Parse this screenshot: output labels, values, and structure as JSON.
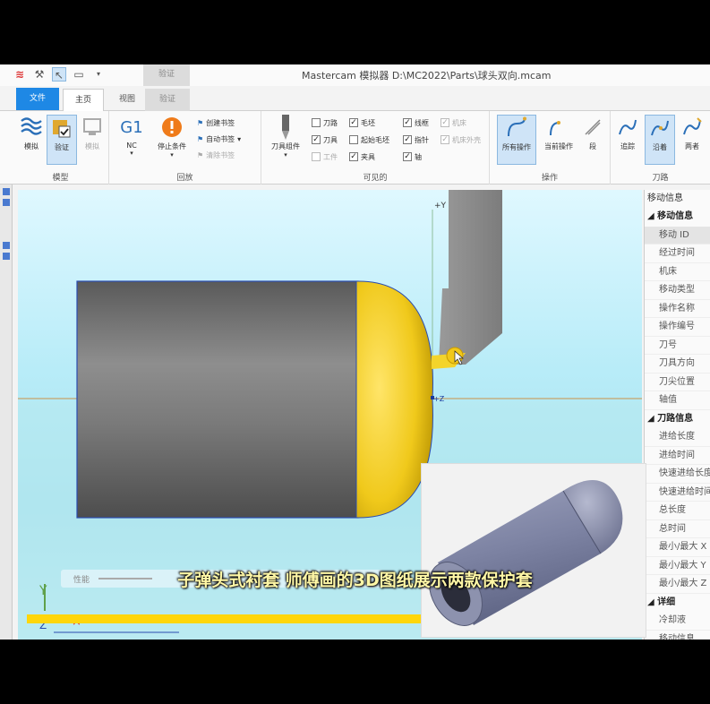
{
  "window": {
    "title": "Mastercam 模拟器  D:\\MC2022\\Parts\\球头双向.mcam",
    "context_tab_group": "验证"
  },
  "quick_access": [
    {
      "icon": "mastercam-logo-icon"
    },
    {
      "icon": "wand-icon"
    },
    {
      "icon": "cursor-icon"
    },
    {
      "icon": "monitor-icon"
    },
    {
      "icon": "dropdown-arrow-icon"
    }
  ],
  "tabs": [
    {
      "label": "文件",
      "name": "file"
    },
    {
      "label": "主页",
      "name": "home"
    },
    {
      "label": "视图",
      "name": "view"
    },
    {
      "label": "验证",
      "name": "verify"
    }
  ],
  "ribbon": {
    "groups": {
      "model": "模型",
      "playback": "回放",
      "visible": "可见的",
      "operations": "操作",
      "toolpath": "刀路"
    },
    "model_buttons": [
      {
        "label": "模拟",
        "icon": "simulate-icon",
        "active": false
      },
      {
        "label": "验证",
        "icon": "verify-icon",
        "active": true
      },
      {
        "label": "模拟",
        "icon": "machine-sim-icon",
        "active": false
      }
    ],
    "nc_label": "NC",
    "nc_icon_text": "G1",
    "stop_label": "停止条件",
    "bookmarks": [
      {
        "label": "创建书签",
        "disabled": false
      },
      {
        "label": "自动书签",
        "disabled": false
      },
      {
        "label": "清除书签",
        "disabled": true
      }
    ],
    "tool_assembly_label": "刀具组件",
    "visible_checks": [
      {
        "label": "刀路",
        "checked": false,
        "disabled": false
      },
      {
        "label": "刀具",
        "checked": true,
        "disabled": false
      },
      {
        "label": "工件",
        "checked": false,
        "disabled": true
      },
      {
        "label": "毛坯",
        "checked": true,
        "disabled": false
      },
      {
        "label": "起始毛坯",
        "checked": false,
        "disabled": false
      },
      {
        "label": "夹具",
        "checked": true,
        "disabled": false
      },
      {
        "label": "线框",
        "checked": true,
        "disabled": false
      },
      {
        "label": "指针",
        "checked": true,
        "disabled": false
      },
      {
        "label": "轴",
        "checked": true,
        "disabled": false
      },
      {
        "label": "机床",
        "checked": true,
        "disabled": true
      },
      {
        "label": "机床外壳",
        "checked": true,
        "disabled": true
      }
    ],
    "operations_buttons": [
      {
        "label": "所有操作",
        "active": true
      },
      {
        "label": "当前操作",
        "active": false
      },
      {
        "label": "段",
        "active": false
      }
    ],
    "toolpath_buttons": [
      {
        "label": "追踪",
        "active": false
      },
      {
        "label": "沿着",
        "active": true
      },
      {
        "label": "两者",
        "active": false
      }
    ]
  },
  "viewport": {
    "axis_y_label": "+Y",
    "axis_z_label": "+Z",
    "bottom_toolbar_label": "性能",
    "triad_labels": {
      "y": "Y",
      "z": "Z"
    }
  },
  "right_panel": {
    "title": "移动信息",
    "sections": [
      {
        "label": "移动信息",
        "rows": [
          "移动 ID",
          "经过时间",
          "机床",
          "移动类型",
          "操作名称",
          "操作编号",
          "刀号",
          "刀具方向",
          "刀尖位置",
          "轴值"
        ]
      },
      {
        "label": "刀路信息",
        "rows": [
          "进给长度",
          "进给时间",
          "快速进给长度",
          "快速进给时间",
          "总长度",
          "总时间",
          "最小/最大 X",
          "最小/最大 Y",
          "最小/最大 Z"
        ]
      },
      {
        "label": "详细",
        "rows": [
          "冷却液"
        ]
      }
    ],
    "footer_label": "移动信息"
  },
  "overlay": {
    "caption": "子弹头式衬套 师傅画的3D图纸展示两款保护套"
  },
  "colors": {
    "accent_blue": "#1e88e5",
    "stock_gray": "#6e6e6e",
    "dome_yellow": "#f2cf1d",
    "caption_yellow": "#fff7a6",
    "bar_yellow": "#ffd60a"
  }
}
